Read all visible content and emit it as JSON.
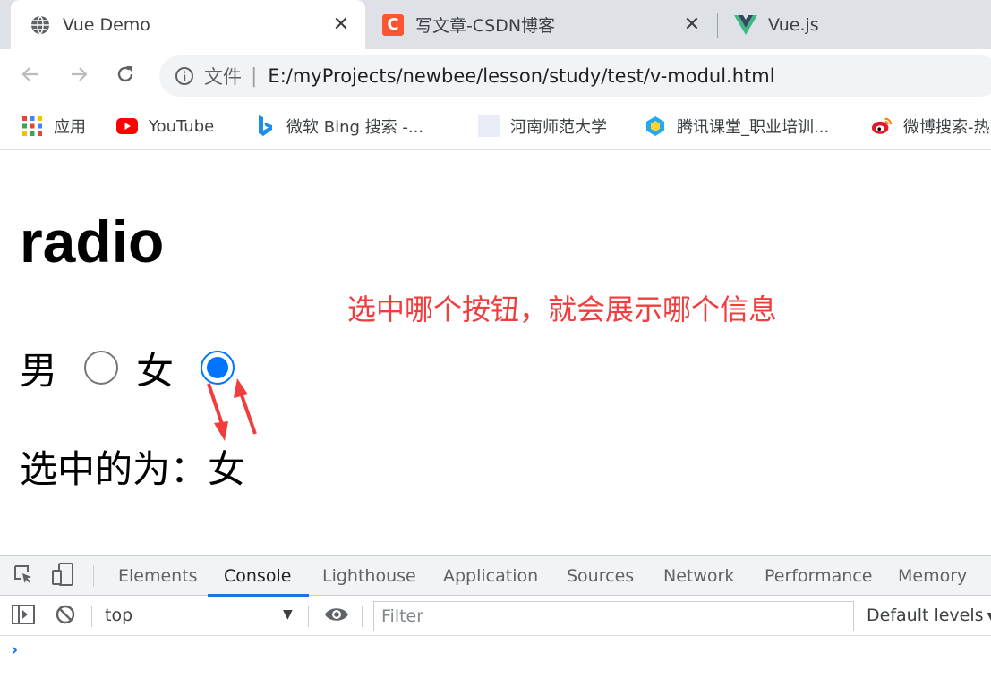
{
  "browser": {
    "tabs": [
      {
        "title": "Vue Demo",
        "icon": "globe-icon",
        "active": true,
        "close": "✕"
      },
      {
        "title": "写文章-CSDN博客",
        "icon": "csdn-icon",
        "icon_letter": "C",
        "active": false,
        "close": "✕"
      },
      {
        "title": "Vue.js",
        "icon": "vue-icon",
        "active": false
      }
    ],
    "address": {
      "scheme_label": "文件",
      "separator": "|",
      "url": "E:/myProjects/newbee/lesson/study/test/v-modul.html"
    },
    "bookmarks": [
      {
        "label": "应用",
        "icon": "apps-grid-icon"
      },
      {
        "label": "YouTube",
        "icon": "youtube-icon"
      },
      {
        "label": "微软 Bing 搜索 -...",
        "icon": "bing-icon"
      },
      {
        "label": "河南师范大学",
        "icon": "blank-page-icon"
      },
      {
        "label": "腾讯课堂_职业培训...",
        "icon": "tencent-classroom-icon"
      },
      {
        "label": "微博搜索-热",
        "icon": "weibo-icon"
      }
    ]
  },
  "page": {
    "heading": "radio",
    "annotation": "选中哪个按钮，就会展示哪个信息",
    "options": [
      {
        "label": "男",
        "checked": false
      },
      {
        "label": "女",
        "checked": true
      }
    ],
    "selected_text": "选中的为：女"
  },
  "devtools": {
    "tabs": [
      "Elements",
      "Console",
      "Lighthouse",
      "Application",
      "Sources",
      "Network",
      "Performance",
      "Memory"
    ],
    "active_tab": "Console",
    "context": "top",
    "filter_placeholder": "Filter",
    "levels": "Default levels",
    "prompt": "›"
  },
  "colors": {
    "accent": "#1a73e8",
    "radio_checked": "#0075ff",
    "annotation": "#f23d3d",
    "tabstrip_bg": "#dee1e6"
  }
}
